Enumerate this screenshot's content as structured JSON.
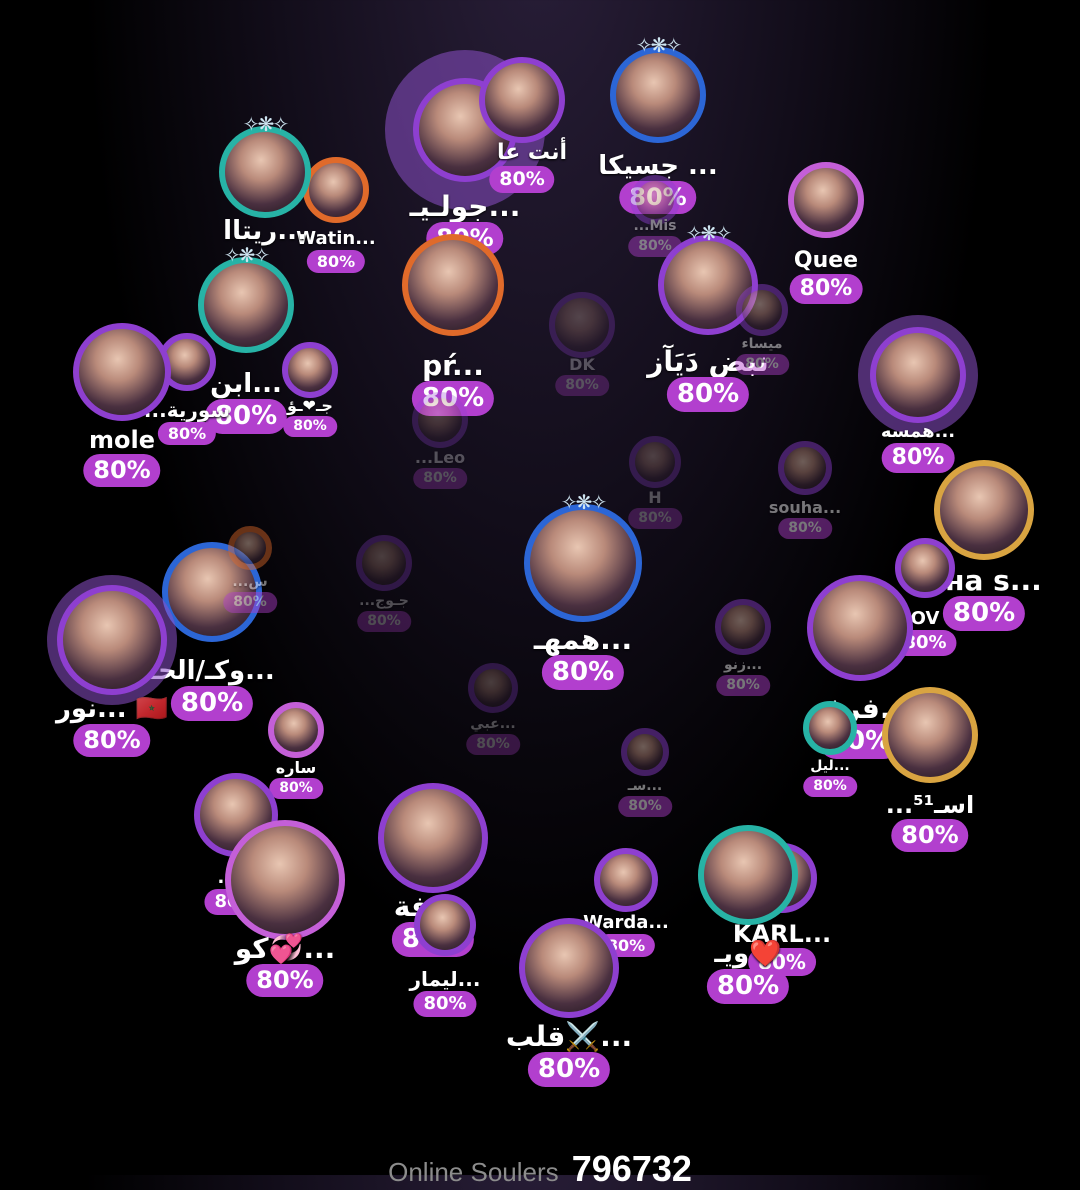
{
  "colors": {
    "badge": "#b23fce",
    "ring_purple": "#8e3fd0",
    "ring_teal": "#27b3a6",
    "ring_blue": "#2c66d6",
    "background": "#000000"
  },
  "souls": [
    {
      "name": "جولـيـ...",
      "percent": "80%"
    },
    {
      "name": "أنت عا",
      "percent": "80%"
    },
    {
      "name": "جسيكا ...",
      "percent": "80%"
    },
    {
      "name": "...Mis",
      "percent": "80%"
    },
    {
      "name": "Watin...",
      "percent": "80%"
    },
    {
      "name": "ريتاا...",
      "percent": ""
    },
    {
      "name": "Quee",
      "percent": "80%"
    },
    {
      "name": "نبض دَيَآز",
      "percent": "80%"
    },
    {
      "name": "ميساء",
      "percent": "80%"
    },
    {
      "name": "pŕ...",
      "percent": "80%"
    },
    {
      "name": "DK",
      "percent": "80%"
    },
    {
      "name": "ابن...",
      "percent": "80%"
    },
    {
      "name": "جـ❤ـؤ",
      "percent": "80%"
    },
    {
      "name": "...سورية",
      "percent": "80%"
    },
    {
      "name": "mole",
      "percent": "80%"
    },
    {
      "name": "همسه...",
      "percent": "80%"
    },
    {
      "name": "...Leo",
      "percent": "80%"
    },
    {
      "name": "H",
      "percent": "80%"
    },
    {
      "name": "souha...",
      "percent": "80%"
    },
    {
      "name": "ана s...",
      "percent": "80%"
    },
    {
      "name": "OV",
      "percent": "80%"
    },
    {
      "name": "همهـ...",
      "percent": "80%"
    },
    {
      "name": "وكـ/الحـ...",
      "percent": "80%"
    },
    {
      "name": "نور... 🇲🇦",
      "percent": "80%"
    },
    {
      "name": "زنو...",
      "percent": "80%"
    },
    {
      "name": "فرفو...",
      "percent": "80%"
    },
    {
      "name": "ساره",
      "percent": "80%"
    },
    {
      "name": "عبي...",
      "percent": "80%"
    },
    {
      "name": "سـ...",
      "percent": "80%"
    },
    {
      "name": "ليل...",
      "percent": "80%"
    },
    {
      "name": "...⁵¹اسـ",
      "percent": "80%"
    },
    {
      "name": "صدفة",
      "percent": "80%"
    },
    {
      "name": "...ي",
      "percent": "80%"
    },
    {
      "name": "كو💞...",
      "percent": "80%"
    },
    {
      "name": "Warda...",
      "percent": "80%"
    },
    {
      "name": "KARL...",
      "percent": "80%"
    },
    {
      "name": "ويـ❤️",
      "percent": "80%"
    },
    {
      "name": "قلب⚔️...",
      "percent": "80%"
    },
    {
      "name": "ليمار...",
      "percent": "80%"
    },
    {
      "name": "...جـوج",
      "percent": "80%"
    },
    {
      "name": "...س",
      "percent": "80%"
    }
  ],
  "footer": {
    "label": "Online Soulers",
    "count": "796732"
  }
}
